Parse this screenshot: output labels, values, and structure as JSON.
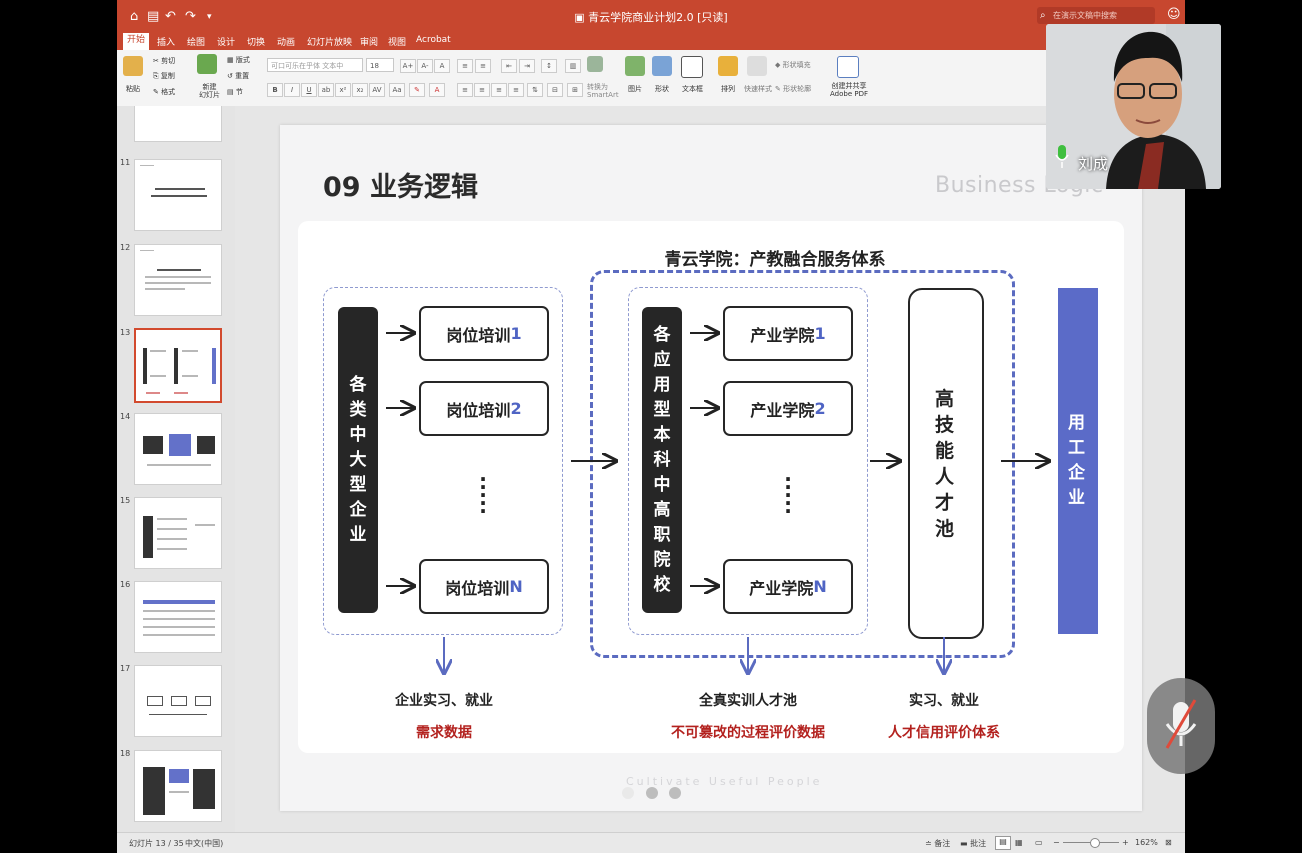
{
  "window": {
    "title": "青云学院商业计划2.0 [只读]",
    "search_placeholder": "在演示文稿中搜索"
  },
  "quick_access": [
    "⌂",
    "▤",
    "↶",
    "↷",
    "▾"
  ],
  "tabs": [
    "开始",
    "插入",
    "绘图",
    "设计",
    "切换",
    "动画",
    "幻灯片放映",
    "审阅",
    "视图",
    "Acrobat"
  ],
  "ribbon": {
    "paste": "粘贴",
    "cut": "剪切",
    "copy": "复制",
    "format": "格式",
    "new_slide": "新建\n幻灯片",
    "layout": "版式",
    "reset": "重置",
    "section": "节",
    "font_name": "可口可乐在乎体 文本中",
    "font_size": "18",
    "convert_smartart": "转换为\nSmartArt",
    "picture": "图片",
    "shape": "形状",
    "textbox": "文本框",
    "arrange": "排列",
    "quick_styles": "快速样式",
    "shape_fill": "形状填充",
    "shape_outline": "形状轮廓",
    "share_pdf": "创建并共享\nAdobe PDF"
  },
  "thumbnails": [
    {
      "num": "11"
    },
    {
      "num": "12"
    },
    {
      "num": "13"
    },
    {
      "num": "14"
    },
    {
      "num": "15"
    },
    {
      "num": "16"
    },
    {
      "num": "17"
    },
    {
      "num": "18"
    }
  ],
  "slide": {
    "title": "09 业务逻辑",
    "subtitle": "Business Logic",
    "system_title": "青云学院：产教融合服务体系",
    "enterprise_bar": "各类中大型企业",
    "training_boxes": [
      {
        "label": "岗位培训",
        "num": "1"
      },
      {
        "label": "岗位培训",
        "num": "2"
      },
      {
        "label": "岗位培训",
        "num": "N"
      }
    ],
    "school_bar": "各应用型本科中高职院校",
    "college_boxes": [
      {
        "label": "产业学院",
        "num": "1"
      },
      {
        "label": "产业学院",
        "num": "2"
      },
      {
        "label": "产业学院",
        "num": "N"
      }
    ],
    "talent_pool": "高技能人才池",
    "employer": "用工企业",
    "bottom_labels": [
      {
        "black": "企业实习、就业",
        "red": "需求数据"
      },
      {
        "black": "全真实训人才池",
        "red": "不可篡改的过程评价数据"
      },
      {
        "black": "实习、就业",
        "red": "人才信用评价体系"
      }
    ],
    "footer": "Cultivate Useful People"
  },
  "webcam": {
    "name": "刘成"
  },
  "statusbar": {
    "slide_info": "幻灯片 13 / 35",
    "language": "中文(中国)",
    "notes": "备注",
    "comments": "批注",
    "zoom": "162%"
  },
  "colors": {
    "brand": "#c7472f",
    "accent_blue": "#5b6bc8",
    "highlight_red": "#b3211e"
  }
}
